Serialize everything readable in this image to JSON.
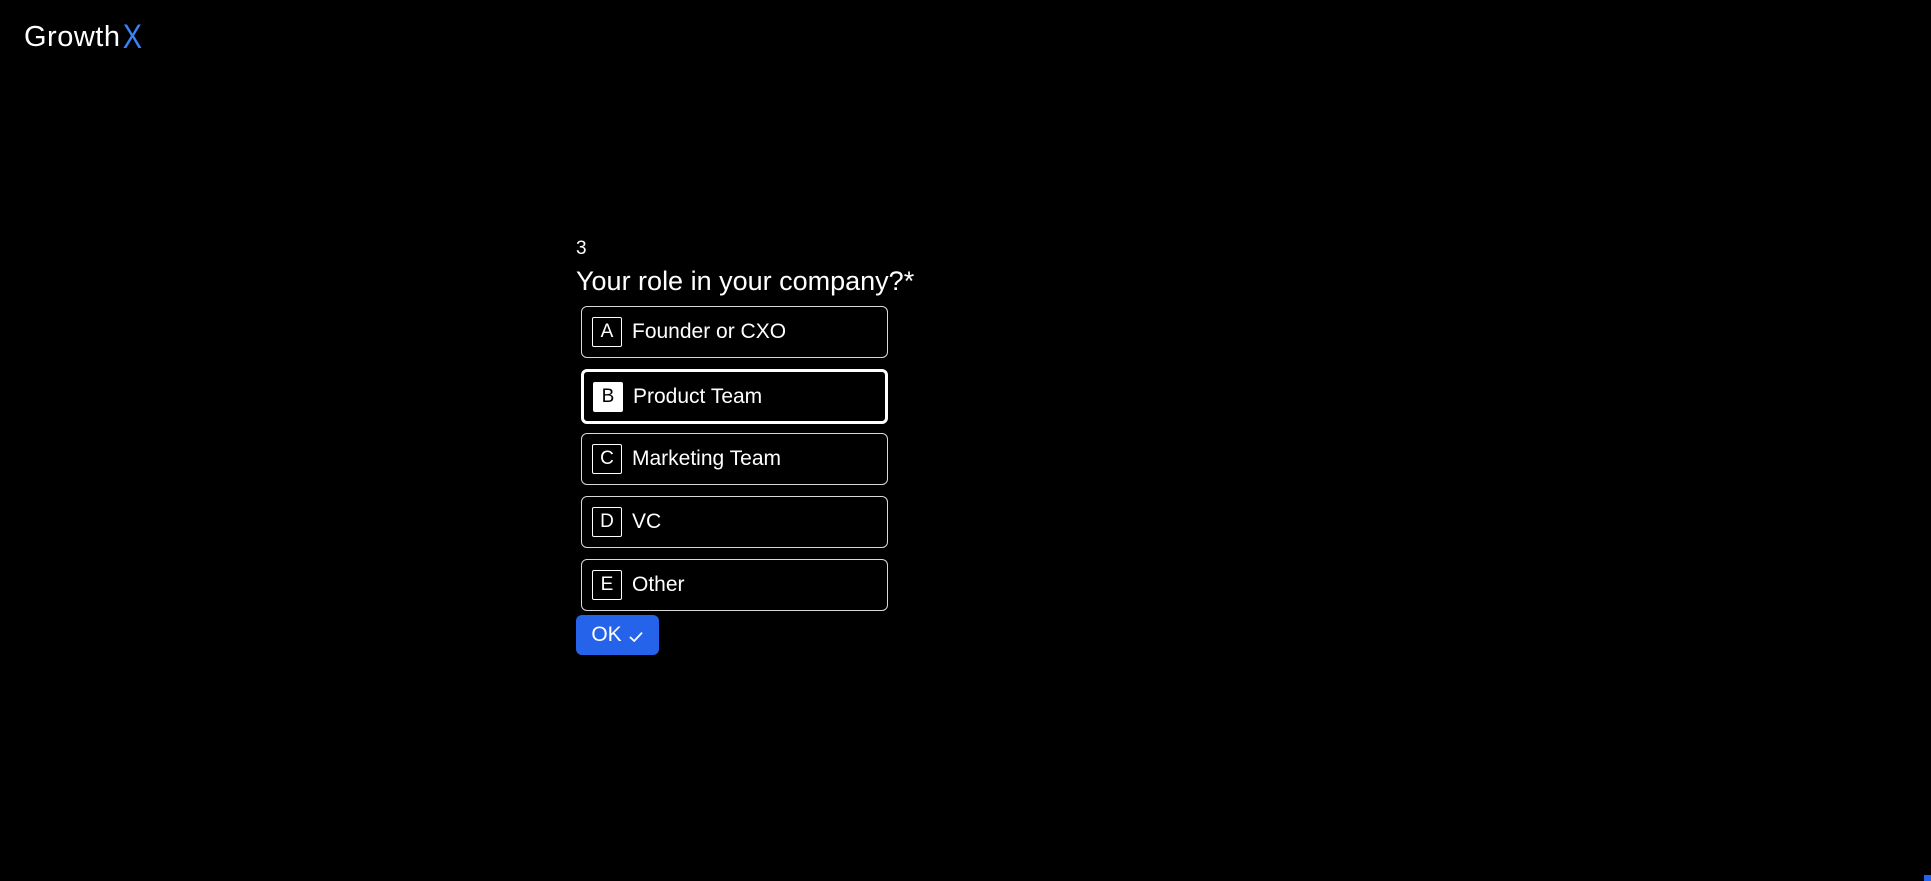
{
  "brand": {
    "name_prefix": "Growth",
    "name_suffix": "X",
    "accent_color": "#3b82f6"
  },
  "question": {
    "number": "3",
    "title": "Your role in your company?*"
  },
  "options": [
    {
      "key": "A",
      "label": "Founder or CXO",
      "selected": false
    },
    {
      "key": "B",
      "label": "Product Team",
      "selected": true
    },
    {
      "key": "C",
      "label": "Marketing Team",
      "selected": false
    },
    {
      "key": "D",
      "label": "VC",
      "selected": false
    },
    {
      "key": "E",
      "label": "Other",
      "selected": false
    }
  ],
  "ok_button": {
    "label": "OK",
    "icon": "check-icon",
    "color": "#2563eb"
  }
}
